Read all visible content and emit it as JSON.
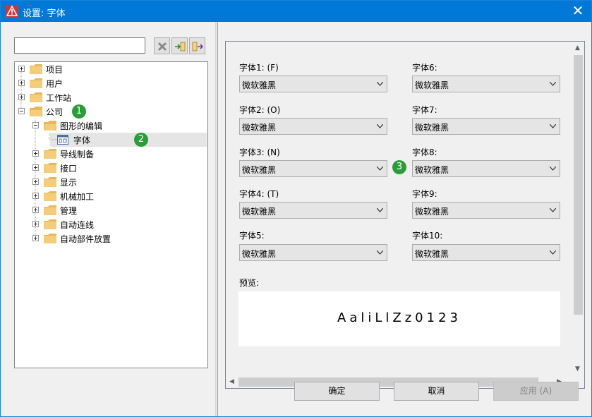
{
  "window": {
    "title": "设置: 字体",
    "close_label": "✕"
  },
  "tree": {
    "nodes": [
      {
        "label": "项目"
      },
      {
        "label": "用户"
      },
      {
        "label": "工作站"
      },
      {
        "label": "公司"
      },
      {
        "label": "图形的编辑"
      },
      {
        "label": "字体"
      },
      {
        "label": "导线制备"
      },
      {
        "label": "接口"
      },
      {
        "label": "显示"
      },
      {
        "label": "机械加工"
      },
      {
        "label": "管理"
      },
      {
        "label": "自动连线"
      },
      {
        "label": "自动部件放置"
      }
    ]
  },
  "badges": [
    "1",
    "2",
    "3"
  ],
  "fonts": {
    "left": [
      {
        "label": "字体1: (F)",
        "value": "微软雅黑"
      },
      {
        "label": "字体2: (O)",
        "value": "微软雅黑"
      },
      {
        "label": "字体3: (N)",
        "value": "微软雅黑"
      },
      {
        "label": "字体4: (T)",
        "value": "微软雅黑"
      },
      {
        "label": "字体5:",
        "value": "微软雅黑"
      }
    ],
    "right": [
      {
        "label": "字体6:",
        "value": "微软雅黑"
      },
      {
        "label": "字体7:",
        "value": "微软雅黑"
      },
      {
        "label": "字体8:",
        "value": "微软雅黑"
      },
      {
        "label": "字体9:",
        "value": "微软雅黑"
      },
      {
        "label": "字体10:",
        "value": "微软雅黑"
      }
    ]
  },
  "preview": {
    "label": "预览:",
    "text": "AaliLlZz0123"
  },
  "buttons": {
    "ok": "确定",
    "cancel": "取消",
    "apply": "应用 (A)"
  },
  "colors": {
    "titlebar": "#0078d7",
    "badge": "#2a9d39",
    "folder": "#e8b85a"
  }
}
